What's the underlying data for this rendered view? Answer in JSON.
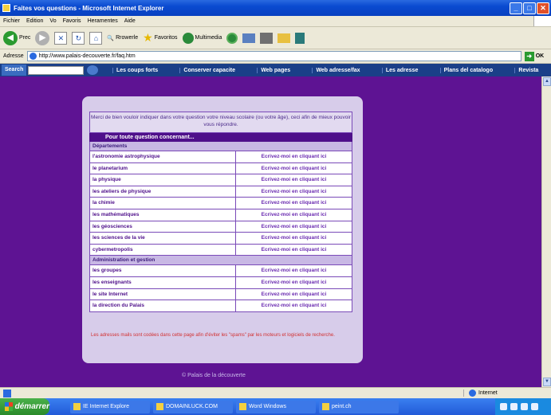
{
  "window": {
    "title": "Faites vos questions - Microsoft Internet Explorer",
    "min_glyph": "_",
    "max_glyph": "□",
    "close_glyph": "✕"
  },
  "menu": [
    "Fichier",
    "Edition",
    "Vo",
    "Favoris",
    "Heramentes",
    "Aide"
  ],
  "toolbar": {
    "back": "Prec",
    "search": "Rrowerle",
    "favorites": "Favoritos",
    "media": "Multimedia"
  },
  "address": {
    "label": "Adresse",
    "url": "http://www.palais-decouverte.fr/faq.htm",
    "go": "OK"
  },
  "links": {
    "search_label": "Search",
    "items": [
      "Les coups forts",
      "Conserver capacite",
      "Web pages",
      "Web adresse/fax",
      "Les adresse",
      "Plans del catalogo",
      "Revista"
    ]
  },
  "content": {
    "intro": "Merci de bien vouloir indiquer dans votre question votre niveau scolaire (ou votre âge), ceci afin de mieux pouvoir vous répondre.",
    "ask_bar": "Pour toute question concernant...",
    "link_text": "Ecrivez-moi en cliquant ici",
    "sections": [
      {
        "title": "Départements",
        "rows": [
          "l'astronomie astrophysique",
          "le planetarium",
          "la physique",
          "les ateliers de physique",
          "la chimie",
          "les mathématiques",
          "les géosciences",
          "les sciences de la vie",
          "cybermetropolis"
        ]
      },
      {
        "title": "Administration et gestion",
        "rows": [
          "les groupes",
          "les enseignants",
          "le site Internet",
          "la direction du Palais"
        ]
      }
    ],
    "note": "Les adresses mails sont codées dans cette page afin d'éviter les \"spams\" par les moteurs et logiciels de recherche.",
    "footer": "© Palais de la découverte"
  },
  "status": {
    "text": "",
    "zone": "Internet"
  },
  "taskbar": {
    "start": "démarrer",
    "tasks": [
      "IE Internet Explore",
      "DOMAINLUCK.COM",
      "Word Windows",
      "peint.ch"
    ]
  }
}
